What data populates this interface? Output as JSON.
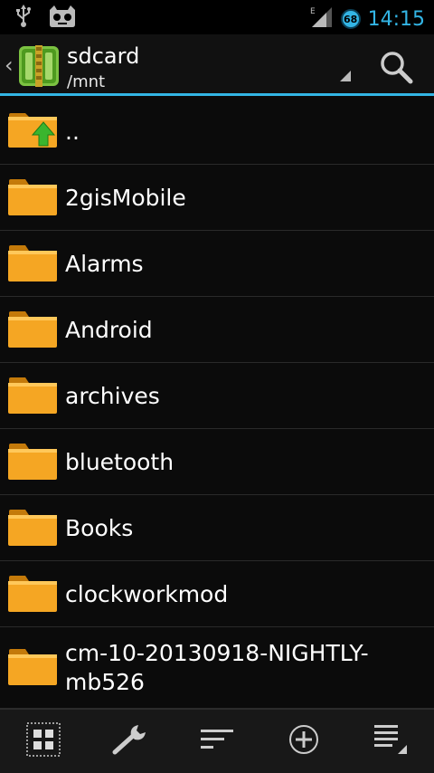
{
  "statusbar": {
    "left_icons": [
      "usb-icon",
      "cyanogen-mascot-icon"
    ],
    "network_type": "E",
    "battery_level": "68",
    "time": "14:15"
  },
  "actionbar": {
    "title": "sdcard",
    "subtitle": "/mnt",
    "accent_color": "#33b5e5"
  },
  "files": [
    {
      "name": "..",
      "type": "parent"
    },
    {
      "name": "2gisMobile",
      "type": "folder"
    },
    {
      "name": "Alarms",
      "type": "folder"
    },
    {
      "name": "Android",
      "type": "folder"
    },
    {
      "name": "archives",
      "type": "folder"
    },
    {
      "name": "bluetooth",
      "type": "folder"
    },
    {
      "name": "Books",
      "type": "folder"
    },
    {
      "name": "clockworkmod",
      "type": "folder"
    },
    {
      "name": "cm-10-20130918-NIGHTLY-mb526",
      "type": "folder"
    }
  ],
  "bottombar": {
    "items": [
      "grid-view-icon",
      "wrench-icon",
      "sort-icon",
      "add-icon",
      "menu-icon"
    ]
  },
  "colors": {
    "folder": "#f5a623",
    "folder_dark": "#c47a0a",
    "accent": "#33b5e5",
    "background": "#0b0b0b"
  }
}
